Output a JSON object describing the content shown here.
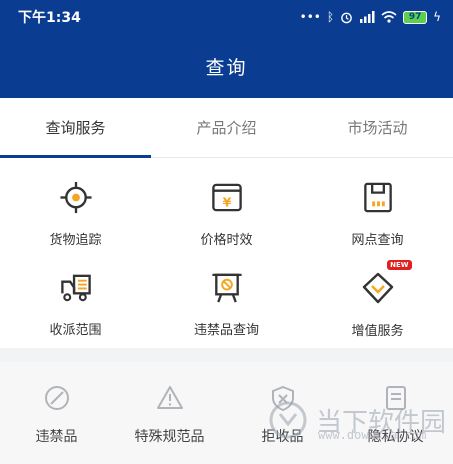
{
  "statusbar": {
    "time": "下午1:34",
    "battery": "97"
  },
  "navbar": {
    "title": "查询"
  },
  "tabs": [
    {
      "label": "查询服务",
      "active": true
    },
    {
      "label": "产品介绍",
      "active": false
    },
    {
      "label": "市场活动",
      "active": false
    }
  ],
  "services": [
    {
      "label": "货物追踪",
      "icon": "target-icon"
    },
    {
      "label": "价格时效",
      "icon": "price-calendar-icon"
    },
    {
      "label": "网点查询",
      "icon": "save-box-icon"
    },
    {
      "label": "收派范围",
      "icon": "delivery-truck-icon"
    },
    {
      "label": "违禁品查询",
      "icon": "prohibited-board-icon"
    },
    {
      "label": "增值服务",
      "icon": "diamond-check-icon",
      "badge": "NEW"
    }
  ],
  "bottom_items": [
    {
      "label": "违禁品",
      "icon": "prohibited-circle-icon"
    },
    {
      "label": "特殊规范品",
      "icon": "warning-triangle-icon"
    },
    {
      "label": "拒收品",
      "icon": "shield-x-icon"
    },
    {
      "label": "隐私协议",
      "icon": "document-icon"
    }
  ],
  "watermark": {
    "text": "当下软件园",
    "url": "www.downxia.com"
  },
  "colors": {
    "primary": "#0a3d91",
    "accent": "#f5a623",
    "badge": "#e02020"
  }
}
